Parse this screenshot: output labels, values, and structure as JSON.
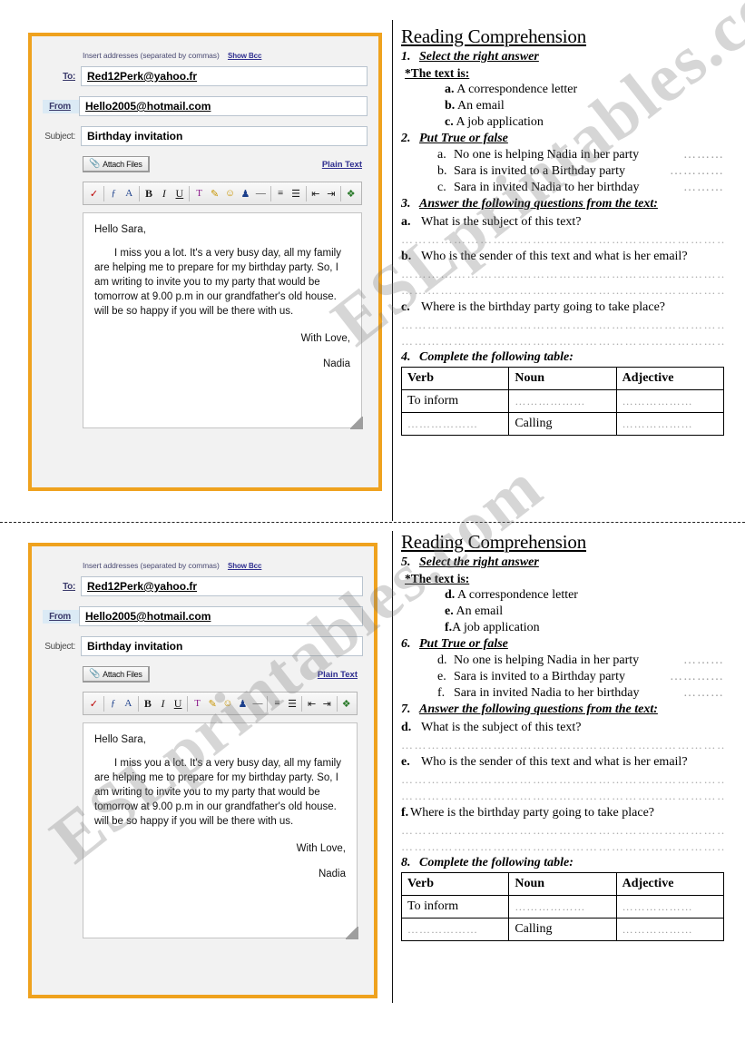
{
  "watermark": {
    "text": "ESLprintables.com"
  },
  "email": {
    "hint": "Insert addresses (separated by commas)",
    "show_bcc": "Show Bcc",
    "to_label": "To:",
    "to_value": "Red12Perk@yahoo.fr",
    "from_label": "From",
    "from_value": "Hello2005@hotmail.com",
    "subject_label": "Subject:",
    "subject_value": "Birthday invitation",
    "attach_label": "Attach Files",
    "plain_text_label": "Plain Text",
    "toolbar": [
      {
        "name": "spellcheck-icon",
        "glyph": "a̲b̲c"
      },
      {
        "name": "font-family-icon",
        "glyph": "ƒ"
      },
      {
        "name": "font-size-icon",
        "glyph": "Aᴀ"
      },
      {
        "name": "bold-icon",
        "glyph": "B"
      },
      {
        "name": "italic-icon",
        "glyph": "I"
      },
      {
        "name": "underline-icon",
        "glyph": "U"
      },
      {
        "name": "text-color-icon",
        "glyph": "T"
      },
      {
        "name": "highlighter-icon",
        "glyph": "✐"
      },
      {
        "name": "emoticon-icon",
        "glyph": "☺"
      },
      {
        "name": "insert-image-icon",
        "glyph": "♟"
      },
      {
        "name": "horizontal-rule-icon",
        "glyph": "—"
      },
      {
        "name": "align-icon",
        "glyph": "≡"
      },
      {
        "name": "bullet-list-icon",
        "glyph": "☰"
      },
      {
        "name": "indent-decrease-icon",
        "glyph": "⇤"
      },
      {
        "name": "indent-increase-icon",
        "glyph": "⇥"
      },
      {
        "name": "insert-link-icon",
        "glyph": "⬟"
      }
    ],
    "body": {
      "greeting": "Hello Sara,",
      "paragraph": "I miss you a lot. It's a very busy day, all my family are helping me to prepare for my birthday party. So, I  am writing  to invite you to my party that would be tomorrow at 9.00 p.m in our grandfather's old house. will be so happy if you will be there with us.",
      "sign_off": "With Love,",
      "signature": "Nadia"
    }
  },
  "worksheet_top": {
    "title": "Reading Comprehension",
    "q1_num": "1.",
    "q1_text": "Select the right answer",
    "star_line": "*The text is:",
    "options": [
      {
        "letter": "a.",
        "text": "A correspondence letter"
      },
      {
        "letter": "b.",
        "text": "An email"
      },
      {
        "letter": "c.",
        "text": "A  job application"
      }
    ],
    "q2_num": "2.",
    "q2_text": "Put True or false",
    "truefalse": [
      {
        "letter": "a.",
        "text": "No one is helping Nadia in her party",
        "dots": "………"
      },
      {
        "letter": "b.",
        "text": "Sara is invited to a Birthday party",
        "dots": "…………"
      },
      {
        "letter": "c.",
        "text": "Sara in invited Nadia to her birthday",
        "dots": "………"
      }
    ],
    "q3_num": "3.",
    "q3_text": "Answer the following questions from the text:",
    "questions": [
      {
        "letter": "a.",
        "text": "What is the subject of this text?",
        "lines": 1
      },
      {
        "letter": "b.",
        "text": "Who is the sender of this text and what is her email?",
        "lines": 2
      },
      {
        "letter": "c.",
        "text": "Where is the birthday party going to take place?",
        "lines": 2
      }
    ],
    "q4_num": "4.",
    "q4_text": "Complete the following table:",
    "table": {
      "headers": [
        "Verb",
        "Noun",
        "Adjective"
      ],
      "rows": [
        [
          "To inform",
          "………………",
          "………………"
        ],
        [
          "………………",
          "Calling",
          "………………"
        ]
      ]
    }
  },
  "worksheet_bottom": {
    "title": "Reading Comprehension",
    "q1_num": "5.",
    "q1_text": "Select the right answer",
    "star_line": "*The text is:",
    "options": [
      {
        "letter": "d.",
        "text": "A correspondence letter"
      },
      {
        "letter": "e.",
        "text": "An email"
      },
      {
        "letter": "f.",
        "text": "A  job application"
      }
    ],
    "q2_num": "6.",
    "q2_text": "Put True or false",
    "truefalse": [
      {
        "letter": "d.",
        "text": "No one is helping Nadia in her party",
        "dots": "………"
      },
      {
        "letter": "e.",
        "text": "Sara is invited to a Birthday party",
        "dots": "…………"
      },
      {
        "letter": "f.",
        "text": "Sara in invited Nadia to her birthday",
        "dots": "………"
      }
    ],
    "q3_num": "7.",
    "q3_text": "Answer the following questions from the text:",
    "questions": [
      {
        "letter": "d.",
        "text": "What is the subject of this text?",
        "lines": 1
      },
      {
        "letter": "e.",
        "text": "Who is the sender of this text and what is her email?",
        "lines": 2
      },
      {
        "letter": "f.",
        "text": "Where is the birthday party going to take place?",
        "lines": 2
      }
    ],
    "q4_num": "8.",
    "q4_text": "Complete the following table:",
    "table": {
      "headers": [
        "Verb",
        "Noun",
        "Adjective"
      ],
      "rows": [
        [
          "To inform",
          "………………",
          "………………"
        ],
        [
          "………………",
          "Calling",
          "………………"
        ]
      ]
    }
  }
}
